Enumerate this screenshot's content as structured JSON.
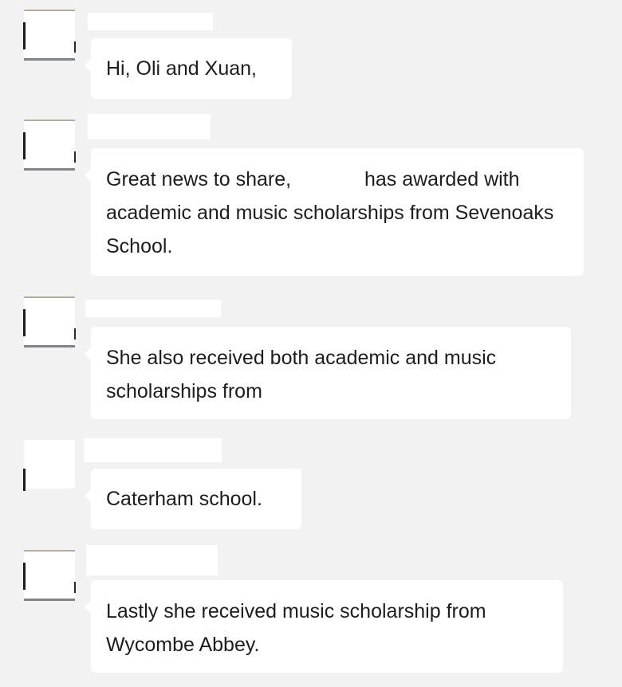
{
  "messages": [
    {
      "text": "Hi, Oli and Xuan,"
    },
    {
      "text_before": "Great news to share,",
      "text_after": "has awarded with academic and music scholarships from Sevenoaks School."
    },
    {
      "text": "She also received both academic and music scholarships from"
    },
    {
      "text": "Caterham school."
    },
    {
      "text": "Lastly she received music scholarship from Wycombe Abbey."
    }
  ]
}
